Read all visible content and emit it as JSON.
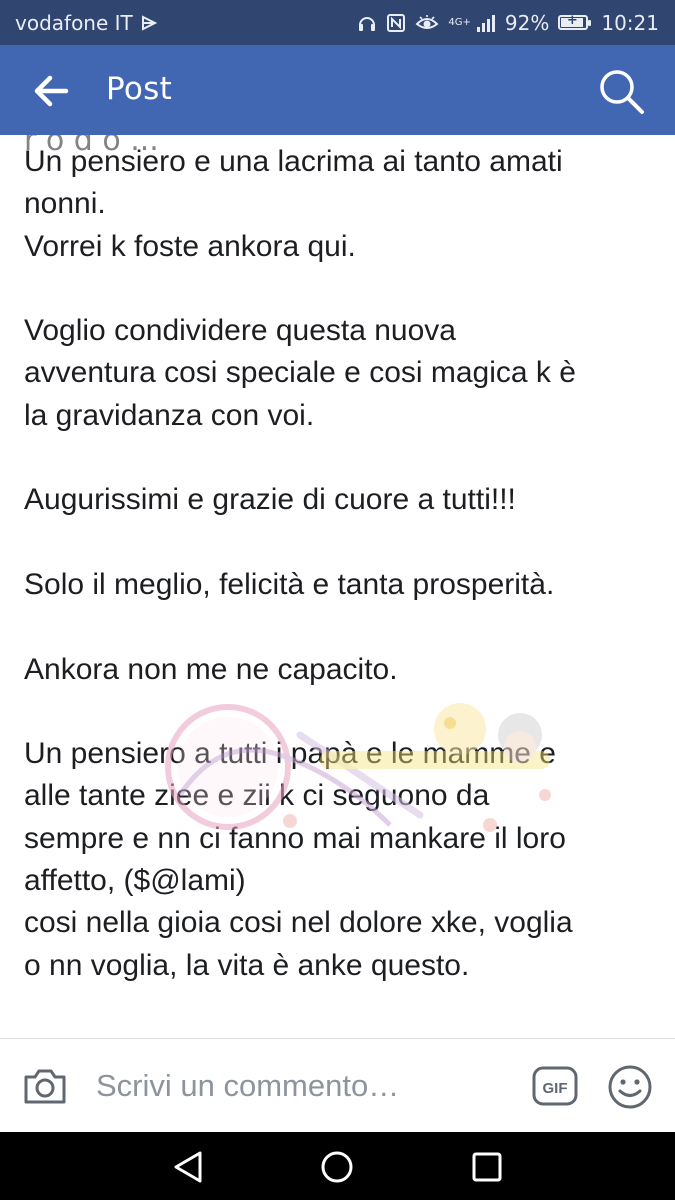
{
  "status_bar": {
    "carrier": "vodafone IT",
    "network": "4G+",
    "battery": "92%",
    "time": "10:21"
  },
  "app_bar": {
    "title": "Post",
    "back_icon": "arrow-left-icon",
    "search_icon": "search-icon"
  },
  "post": {
    "cut_line": "r o d o ...",
    "text": "Un pensiero e una lacrima ai tanto amati\nnonni.\nVorrei k foste ankora qui.\n\nVoglio condividere questa nuova\navventura cosi  speciale e cosi magica k è\nla  gravidanza con voi.\n\nAugurissimi e grazie di cuore a tutti!!!\n\nSolo il meglio, felicità e tanta prosperità.\n\nAnkora non me ne capacito.\n\nUn pensiero a tutti i papà e le mamme e\nalle tante ziee e zii k ci seguono da\nsempre e nn ci fanno mai mankare il loro\naffetto, ($@lami)\ncosi nella gioia cosi  nel dolore xke, voglia\no nn voglia, la vita è anke questo.",
    "watermark_icon": "watermark-logo"
  },
  "comment_bar": {
    "placeholder": "Scrivi un commento…",
    "camera_icon": "camera-icon",
    "gif_label": "GIF",
    "emoji_icon": "smiley-icon"
  },
  "nav_bar": {
    "back_icon": "triangle-back-icon",
    "home_icon": "circle-home-icon",
    "recents_icon": "square-recents-icon"
  }
}
